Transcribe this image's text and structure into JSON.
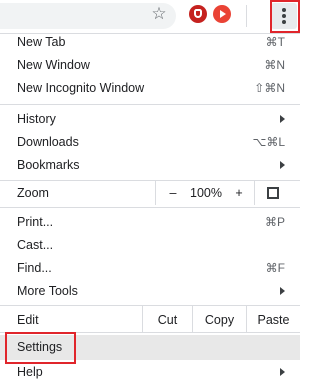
{
  "toolbar": {
    "icons": [
      "star-icon",
      "extension-icon",
      "youtube-icon",
      "more-vert-icon"
    ],
    "highlight_color": "#e0252b"
  },
  "menu": {
    "new_tab": {
      "label": "New Tab",
      "shortcut": "⌘T"
    },
    "new_window": {
      "label": "New Window",
      "shortcut": "⌘N"
    },
    "new_incognito": {
      "label": "New Incognito Window",
      "shortcut": "⇧⌘N"
    },
    "history": {
      "label": "History"
    },
    "downloads": {
      "label": "Downloads",
      "shortcut": "⌥⌘L"
    },
    "bookmarks": {
      "label": "Bookmarks"
    },
    "zoom": {
      "label": "Zoom",
      "minus": "–",
      "value": "100%",
      "plus": "+"
    },
    "print": {
      "label": "Print...",
      "shortcut": "⌘P"
    },
    "cast": {
      "label": "Cast..."
    },
    "find": {
      "label": "Find...",
      "shortcut": "⌘F"
    },
    "more_tools": {
      "label": "More Tools"
    },
    "edit": {
      "label": "Edit",
      "cut": "Cut",
      "copy": "Copy",
      "paste": "Paste"
    },
    "settings": {
      "label": "Settings"
    },
    "help": {
      "label": "Help"
    }
  }
}
